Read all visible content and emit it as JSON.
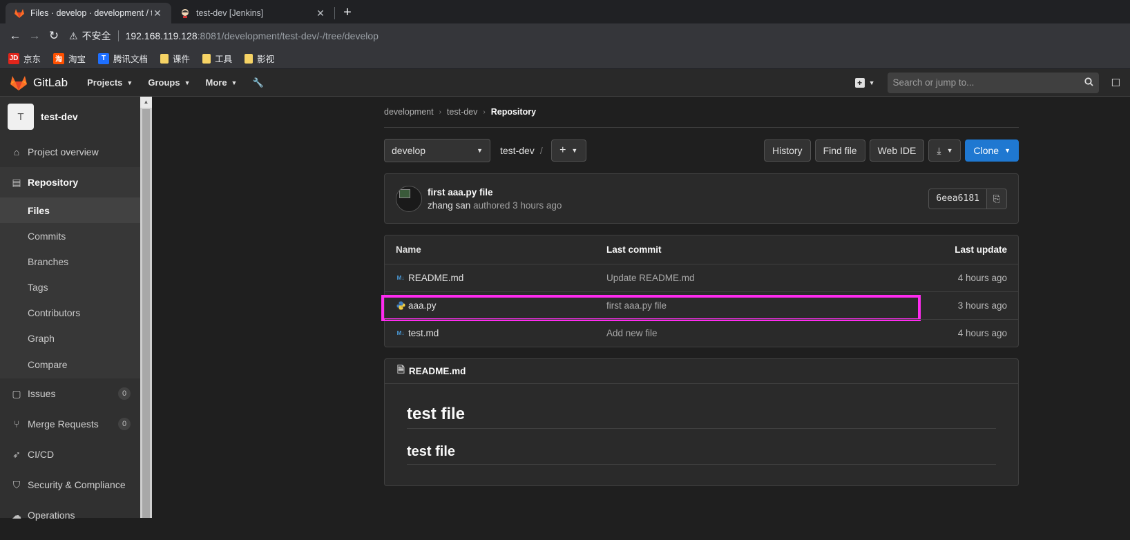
{
  "browser": {
    "tabs": [
      {
        "title": "Files · develop · development / test-dev",
        "active": true
      },
      {
        "title": "test-dev [Jenkins]",
        "active": false
      }
    ],
    "address": {
      "insecure_label": "不安全",
      "host": "192.168.119.128",
      "path": ":8081/development/test-dev/-/tree/develop"
    },
    "bookmarks": [
      {
        "label": "京东",
        "icon": "jd-icon"
      },
      {
        "label": "淘宝",
        "icon": "taobao-icon"
      },
      {
        "label": "腾讯文档",
        "icon": "tencent-docs-icon"
      },
      {
        "label": "课件",
        "icon": "folder-icon"
      },
      {
        "label": "工具",
        "icon": "folder-icon"
      },
      {
        "label": "影视",
        "icon": "folder-icon"
      }
    ]
  },
  "header": {
    "brand": "GitLab",
    "nav": [
      "Projects",
      "Groups",
      "More"
    ],
    "search_placeholder": "Search or jump to..."
  },
  "sidebar": {
    "project_initial": "T",
    "project_name": "test-dev",
    "items": [
      {
        "label": "Project overview"
      },
      {
        "label": "Repository"
      },
      {
        "label": "Issues",
        "count": "0"
      },
      {
        "label": "Merge Requests",
        "count": "0"
      },
      {
        "label": "CI/CD"
      },
      {
        "label": "Security & Compliance"
      },
      {
        "label": "Operations"
      }
    ],
    "repo_sub": [
      "Files",
      "Commits",
      "Branches",
      "Tags",
      "Contributors",
      "Graph",
      "Compare"
    ]
  },
  "breadcrumb": [
    "development",
    "test-dev",
    "Repository"
  ],
  "toolbar": {
    "branch": "develop",
    "repo_name": "test-dev",
    "history": "History",
    "find_file": "Find file",
    "web_ide": "Web IDE",
    "clone": "Clone"
  },
  "commit": {
    "title": "first aaa.py file",
    "author": "zhang san",
    "meta": "authored 3 hours ago",
    "sha": "6eea6181"
  },
  "files": {
    "headers": {
      "name": "Name",
      "last_commit": "Last commit",
      "last_update": "Last update"
    },
    "rows": [
      {
        "name": "README.md",
        "commit": "Update README.md",
        "updated": "4 hours ago",
        "icon": "markdown-icon"
      },
      {
        "name": "aaa.py",
        "commit": "first aaa.py file",
        "updated": "3 hours ago",
        "icon": "python-icon"
      },
      {
        "name": "test.md",
        "commit": "Add new file",
        "updated": "4 hours ago",
        "icon": "markdown-icon"
      }
    ]
  },
  "readme": {
    "filename": "README.md",
    "h1": "test file",
    "h2": "test file"
  },
  "colors": {
    "highlight": "#ff2bf0",
    "clone_button": "#1f78d1"
  }
}
